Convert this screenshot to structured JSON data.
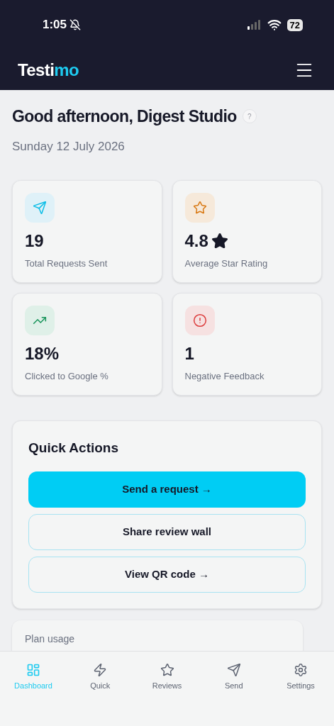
{
  "status_bar": {
    "time": "1:05",
    "battery": "72"
  },
  "header": {
    "logo_start": "Testi",
    "logo_end": "mo"
  },
  "greeting": {
    "title": "Good afternoon, Digest Studio",
    "help": "?",
    "date": "Sunday 12 July 2026"
  },
  "stats": [
    {
      "kind": "send",
      "value": "19",
      "label": "Total Requests Sent"
    },
    {
      "kind": "rating",
      "value": "4.8",
      "label": "Average Star Rating"
    },
    {
      "kind": "trend",
      "value": "18%",
      "label": "Clicked to Google %"
    },
    {
      "kind": "alert",
      "value": "1",
      "label": "Negative Feedback"
    }
  ],
  "quick_actions": {
    "title": "Quick Actions",
    "buttons": [
      {
        "kind": "primary",
        "label": "Send a request →"
      },
      {
        "kind": "outline",
        "label": "Share review wall"
      },
      {
        "kind": "outline",
        "label": "View QR code →"
      }
    ]
  },
  "plan_usage": {
    "title": "Plan usage"
  },
  "nav": [
    {
      "kind": "dashboard",
      "label": "Dashboard",
      "selected": true
    },
    {
      "kind": "quick",
      "label": "Quick",
      "selected": false
    },
    {
      "kind": "reviews",
      "label": "Reviews",
      "selected": false
    },
    {
      "kind": "send",
      "label": "Send",
      "selected": false
    },
    {
      "kind": "settings",
      "label": "Settings",
      "selected": false
    }
  ]
}
